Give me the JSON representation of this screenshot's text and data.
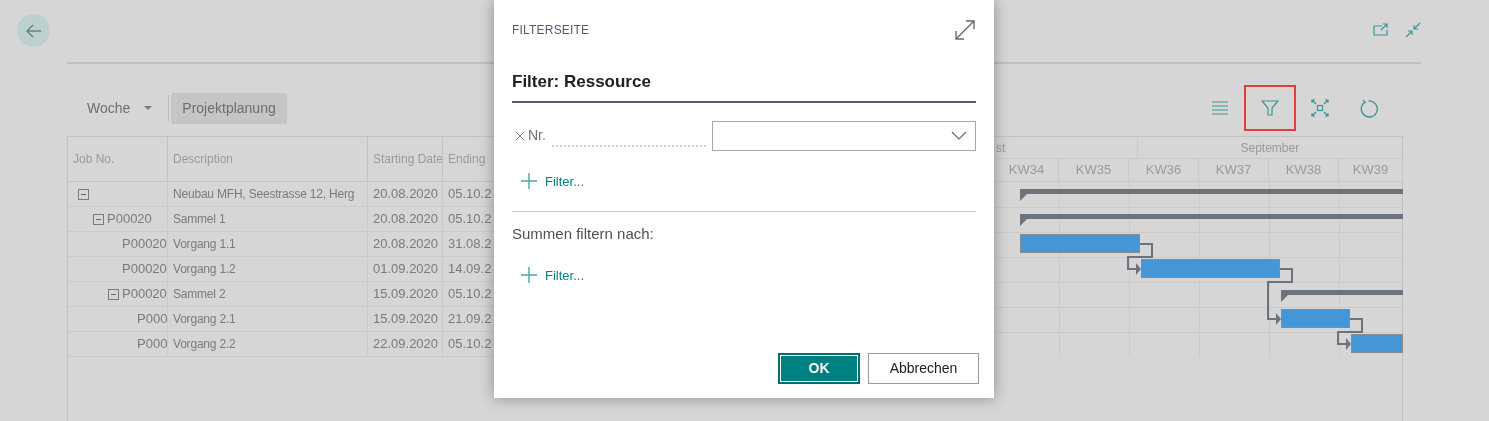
{
  "toolbar": {
    "view_select": "Woche",
    "tabs": [
      {
        "label": "Projektplanung",
        "selected": true
      }
    ],
    "chart_tools": [
      {
        "kind": "list",
        "highlighted": false
      },
      {
        "kind": "filter",
        "highlighted": true
      },
      {
        "kind": "fit",
        "highlighted": false
      },
      {
        "kind": "refresh",
        "highlighted": false
      }
    ]
  },
  "grid": {
    "columns": [
      "Job No.",
      "Description",
      "Starting Date",
      "Ending"
    ],
    "rows": [
      {
        "description": "Neubau MFH, Seestrasse 12, Herg",
        "start": "20.08.2020",
        "end": "05.10.2",
        "expanded": true,
        "children": [
          {
            "job_no": "P00020",
            "description": "Sammel 1",
            "start": "20.08.2020",
            "end": "05.10.2",
            "expanded": true,
            "children": [
              {
                "job_no": "P00020",
                "description": "Vorgang 1.1",
                "start": "20.08.2020",
                "end": "31.08.2"
              },
              {
                "job_no": "P00020",
                "description": "Vorgang 1.2",
                "start": "01.09.2020",
                "end": "14.09.2"
              },
              {
                "job_no": "P00020",
                "description": "Sammel 2",
                "start": "15.09.2020",
                "end": "05.10.2",
                "expanded": true,
                "children": [
                  {
                    "job_no": "P000",
                    "description": "Vorgang 2.1",
                    "start": "15.09.2020",
                    "end": "21.09.2"
                  },
                  {
                    "job_no": "P000",
                    "description": "Vorgang 2.2",
                    "start": "22.09.2020",
                    "end": "05.10.2"
                  }
                ]
              }
            ]
          }
        ]
      }
    ]
  },
  "gantt": {
    "months": [
      "st",
      "September"
    ],
    "weeks": [
      "KW34",
      "KW35",
      "KW36",
      "KW37",
      "KW38",
      "KW39"
    ]
  },
  "dialog": {
    "caption": "FILTERSEITE",
    "title": "Filter: Ressource",
    "filters": [
      {
        "field": "Nr."
      }
    ],
    "add_filter": "Filter...",
    "totals_heading": "Summen filtern nach:",
    "totals_add_filter": "Filter...",
    "buttons": [
      {
        "label": "OK",
        "kind": "primary"
      },
      {
        "label": "Abbrechen",
        "kind": "secondary"
      }
    ]
  }
}
